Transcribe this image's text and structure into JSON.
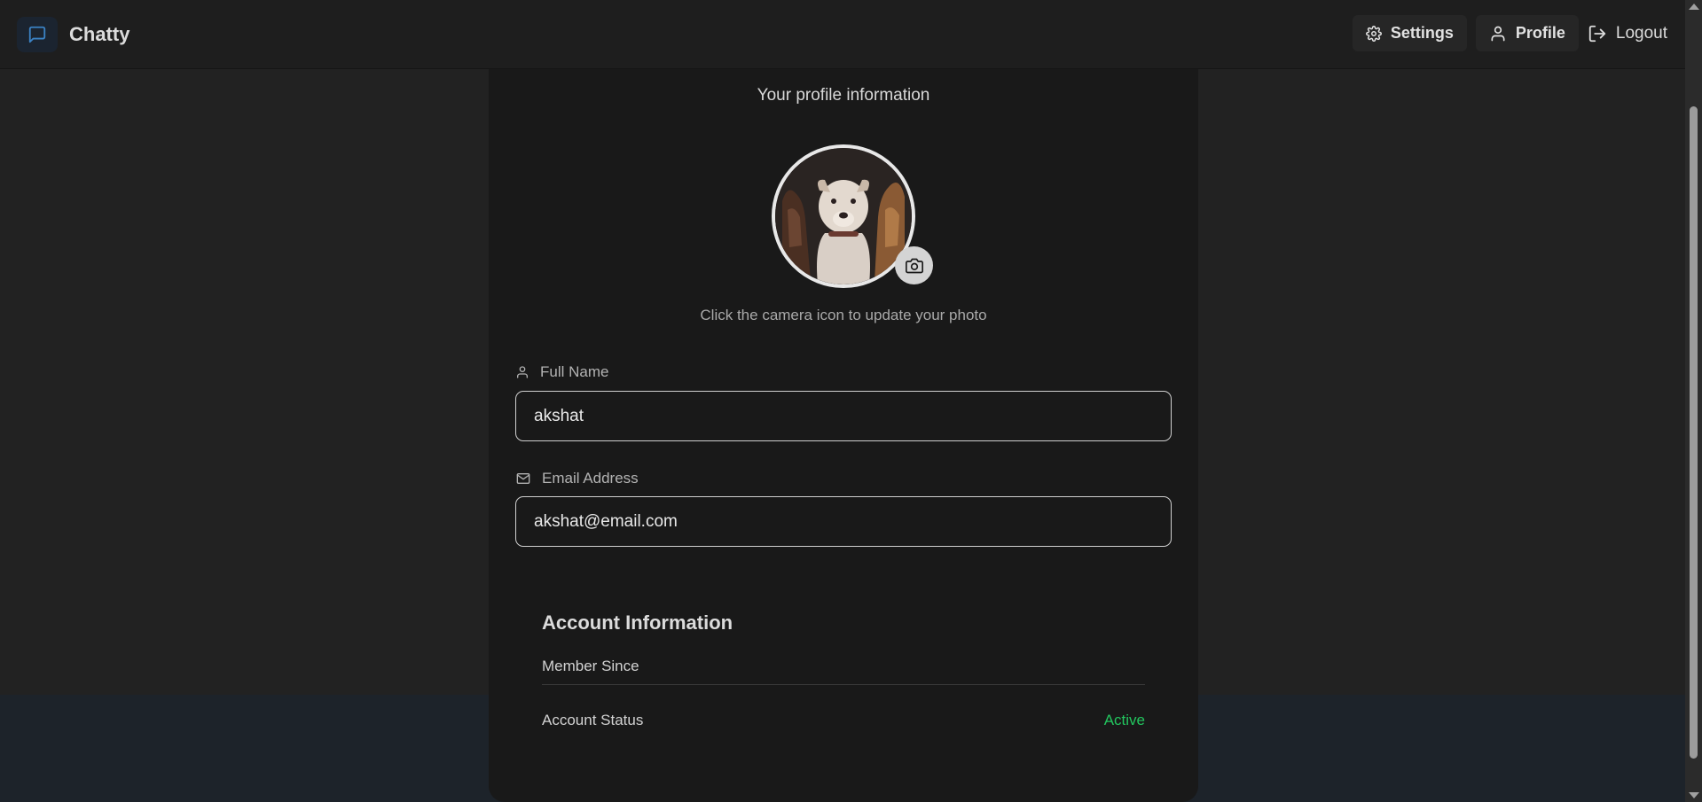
{
  "app": {
    "name": "Chatty"
  },
  "nav": {
    "settings_label": "Settings",
    "profile_label": "Profile",
    "logout_label": "Logout"
  },
  "profile": {
    "subtitle": "Your profile information",
    "avatar_alt": "Profile photo of dogs",
    "photo_hint": "Click the camera icon to update your photo",
    "full_name_label": "Full Name",
    "full_name_value": "akshat",
    "email_label": "Email Address",
    "email_value": "akshat@email.com"
  },
  "account": {
    "title": "Account Information",
    "member_since_label": "Member Since",
    "member_since_value": "",
    "status_label": "Account Status",
    "status_value": "Active",
    "status_color": "#22c55e"
  },
  "icons": {
    "brand": "message-square-icon",
    "settings": "gear-icon",
    "profile": "user-icon",
    "logout": "logout-icon",
    "camera": "camera-icon",
    "name": "user-icon",
    "email": "mail-icon"
  }
}
